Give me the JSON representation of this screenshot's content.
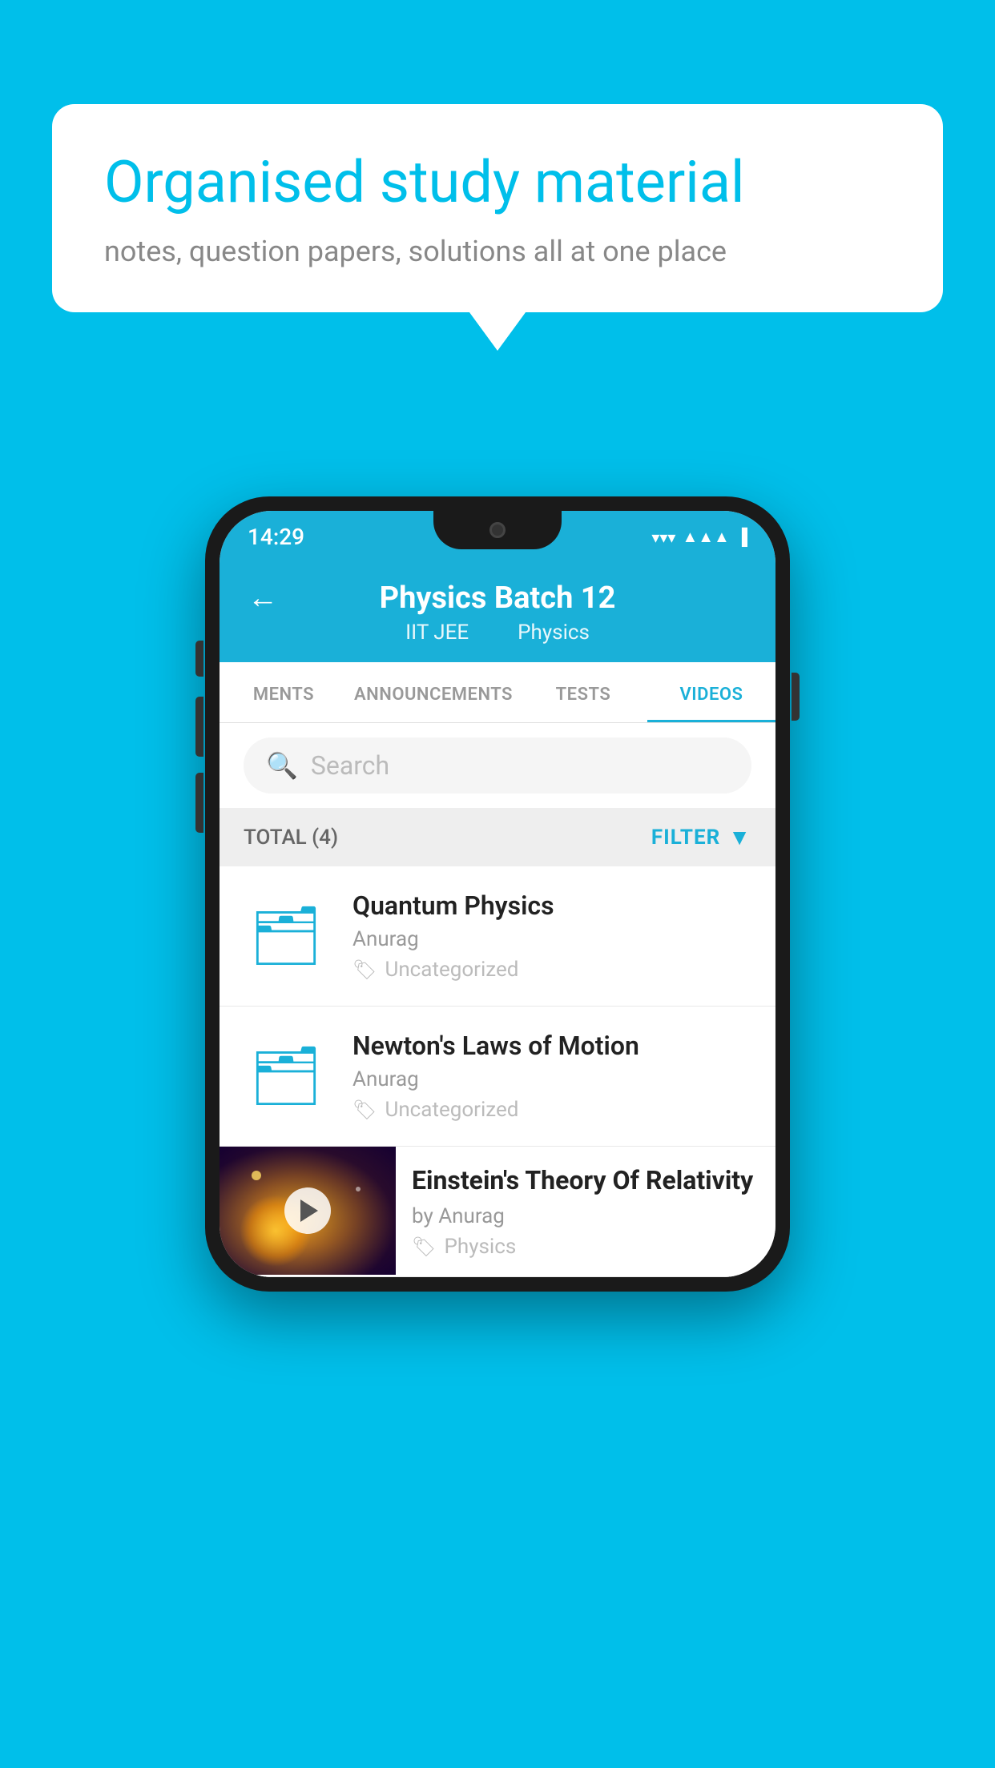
{
  "background_color": "#00BFEA",
  "speech_bubble": {
    "title": "Organised study material",
    "subtitle": "notes, question papers, solutions all at one place"
  },
  "phone": {
    "status_bar": {
      "time": "14:29"
    },
    "header": {
      "title": "Physics Batch 12",
      "tag1": "IIT JEE",
      "tag2": "Physics",
      "back_label": "←"
    },
    "tabs": [
      {
        "label": "MENTS",
        "active": false
      },
      {
        "label": "ANNOUNCEMENTS",
        "active": false
      },
      {
        "label": "TESTS",
        "active": false
      },
      {
        "label": "VIDEOS",
        "active": true
      }
    ],
    "search": {
      "placeholder": "Search"
    },
    "filter_bar": {
      "total": "TOTAL (4)",
      "filter_label": "FILTER"
    },
    "videos": [
      {
        "title": "Quantum Physics",
        "author": "Anurag",
        "tag": "Uncategorized",
        "has_thumb": false
      },
      {
        "title": "Newton's Laws of Motion",
        "author": "Anurag",
        "tag": "Uncategorized",
        "has_thumb": false
      },
      {
        "title": "Einstein's Theory Of Relativity",
        "author": "by Anurag",
        "tag": "Physics",
        "has_thumb": true
      }
    ]
  }
}
